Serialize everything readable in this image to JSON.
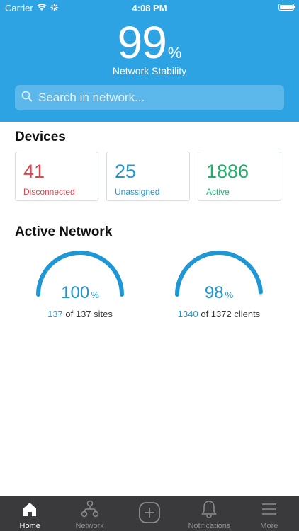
{
  "status_bar": {
    "carrier": "Carrier",
    "time": "4:08 PM"
  },
  "stability": {
    "value": "99",
    "unit": "%",
    "label": "Network Stability"
  },
  "search": {
    "placeholder": "Search in network..."
  },
  "devices": {
    "title": "Devices",
    "cards": [
      {
        "value": "41",
        "label": "Disconnected",
        "color": "#e8414a"
      },
      {
        "value": "25",
        "label": "Unassigned",
        "color": "#1f97d4"
      },
      {
        "value": "1886",
        "label": "Active",
        "color": "#1fb06a"
      }
    ]
  },
  "active_network": {
    "title": "Active Network",
    "sites": {
      "percent": "100",
      "unit": "%",
      "fraction": 1.0,
      "count": "137",
      "rest": "of 137 sites"
    },
    "clients": {
      "percent": "98",
      "unit": "%",
      "fraction": 0.98,
      "count": "1340",
      "rest": "of 1372 clients"
    }
  },
  "colors": {
    "header": "#2ea3e3",
    "accent": "#1f97d4",
    "tabbar": "#3a3a3c"
  },
  "tabbar": {
    "items": [
      {
        "label": "Home",
        "icon": "home-icon",
        "active": true
      },
      {
        "label": "Network",
        "icon": "network-icon",
        "active": false
      },
      {
        "label": "",
        "icon": "add-icon",
        "active": false
      },
      {
        "label": "Notifications",
        "icon": "bell-icon",
        "active": false
      },
      {
        "label": "More",
        "icon": "menu-icon",
        "active": false
      }
    ]
  }
}
